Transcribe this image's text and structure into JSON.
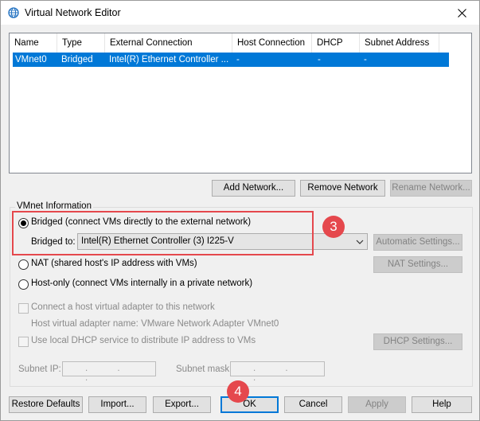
{
  "window": {
    "title": "Virtual Network Editor",
    "icon": "globe-icon",
    "close_icon": "close-icon"
  },
  "table": {
    "headers": [
      "Name",
      "Type",
      "External Connection",
      "Host Connection",
      "DHCP",
      "Subnet Address"
    ],
    "rows": [
      [
        "VMnet0",
        "Bridged",
        "Intel(R) Ethernet Controller ...",
        "-",
        "-",
        "-"
      ]
    ],
    "selected_row_color": "#0078d7"
  },
  "table_buttons": {
    "add": "Add Network...",
    "remove": "Remove Network",
    "rename": "Rename Network..."
  },
  "vmnet_info": {
    "label": "VMnet Information",
    "bridged_label": "Bridged (connect VMs directly to the external network)",
    "bridged_to_label": "Bridged to:",
    "bridged_to_value": "Intel(R) Ethernet Controller (3) I225-V",
    "automatic_settings": "Automatic Settings...",
    "nat_label": "NAT (shared host's IP address with VMs)",
    "nat_settings": "NAT Settings...",
    "hostonly_label": "Host-only (connect VMs internally in a private network)",
    "connect_adapter_label": "Connect a host virtual adapter to this network",
    "adapter_name_label": "Host virtual adapter name: VMware Network Adapter VMnet0",
    "dhcp_label": "Use local DHCP service to distribute IP address to VMs",
    "dhcp_settings": "DHCP Settings...",
    "subnet_ip_label": "Subnet IP:",
    "subnet_mask_label": "Subnet mask:",
    "ip_dots": ". . ."
  },
  "annotations": {
    "badge_3": "3",
    "badge_4": "4",
    "accent": "#e5484d"
  },
  "footer": {
    "restore": "Restore Defaults",
    "import": "Import...",
    "export": "Export...",
    "ok": "OK",
    "cancel": "Cancel",
    "apply": "Apply",
    "help": "Help"
  }
}
